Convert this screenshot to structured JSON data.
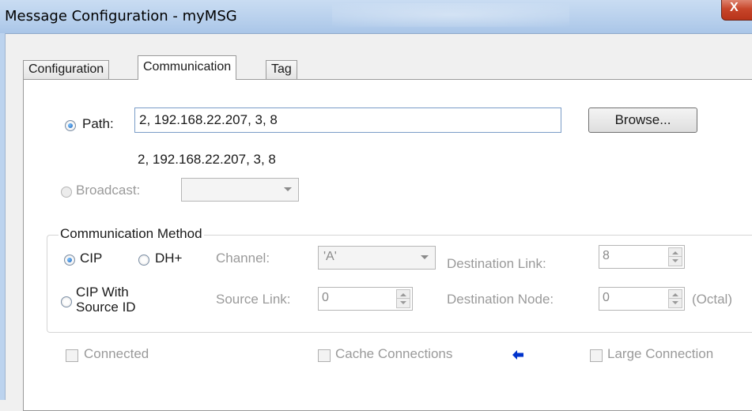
{
  "window": {
    "title": "Message Configuration - myMSG",
    "close_label": "X"
  },
  "tabs": [
    {
      "label": "Configuration",
      "active": false
    },
    {
      "label": "Communication",
      "active": true
    },
    {
      "label": "Tag",
      "active": false
    }
  ],
  "path": {
    "radio_label": "Path:",
    "value": "2, 192.168.22.207, 3, 8",
    "echo": "2, 192.168.22.207, 3, 8",
    "browse_label": "Browse...",
    "selected": true
  },
  "broadcast": {
    "label": "Broadcast:",
    "value": "",
    "enabled": false
  },
  "communication_method": {
    "legend": "Communication Method",
    "cip_label": "CIP",
    "dhplus_label": "DH+",
    "cip_source_line1": "CIP With",
    "cip_source_line2": "Source ID",
    "selected": "CIP",
    "channel_label": "Channel:",
    "channel_value": "'A'",
    "destination_link_label": "Destination Link:",
    "destination_link_value": "8",
    "source_link_label": "Source Link:",
    "source_link_value": "0",
    "destination_node_label": "Destination Node:",
    "destination_node_value": "0",
    "octal_label": "(Octal)"
  },
  "options": {
    "connected_label": "Connected",
    "cache_label": "Cache Connections",
    "large_label": "Large Connection",
    "connected": false,
    "cache": false,
    "large": false
  },
  "colors": {
    "accent_arrow": "#0033cc",
    "selection_blue": "#1c5fb4"
  }
}
